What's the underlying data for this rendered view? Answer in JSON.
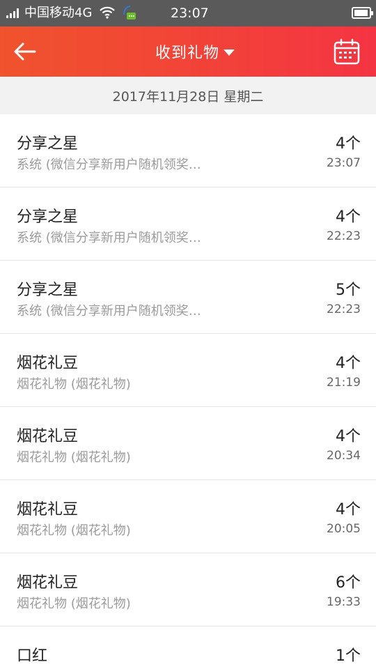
{
  "status_bar": {
    "carrier": "中国移动4G",
    "time": "23:07",
    "battery_level": 0.95
  },
  "header": {
    "title": "收到礼物"
  },
  "date_band": {
    "text": "2017年11月28日 星期二"
  },
  "gifts": [
    {
      "name": "分享之星",
      "source": "系统 (微信分享新用户随机领奖…",
      "count": "4个",
      "time": "23:07"
    },
    {
      "name": "分享之星",
      "source": "系统 (微信分享新用户随机领奖…",
      "count": "4个",
      "time": "22:23"
    },
    {
      "name": "分享之星",
      "source": "系统 (微信分享新用户随机领奖…",
      "count": "5个",
      "time": "22:23"
    },
    {
      "name": "烟花礼豆",
      "source": "烟花礼物 (烟花礼物)",
      "count": "4个",
      "time": "21:19"
    },
    {
      "name": "烟花礼豆",
      "source": "烟花礼物 (烟花礼物)",
      "count": "4个",
      "time": "20:34"
    },
    {
      "name": "烟花礼豆",
      "source": "烟花礼物 (烟花礼物)",
      "count": "4个",
      "time": "20:05"
    },
    {
      "name": "烟花礼豆",
      "source": "烟花礼物 (烟花礼物)",
      "count": "6个",
      "time": "19:33"
    },
    {
      "name": "口红",
      "source": "",
      "count": "1个",
      "time": ""
    }
  ],
  "colors": {
    "header_start": "#f0532d",
    "header_end": "#f43442",
    "status_bar": "#5a5a5a",
    "date_band": "#f2f2f2"
  },
  "icons": {
    "back": "arrow-left-icon",
    "calendar": "calendar-icon",
    "dropdown": "caret-down-icon"
  }
}
